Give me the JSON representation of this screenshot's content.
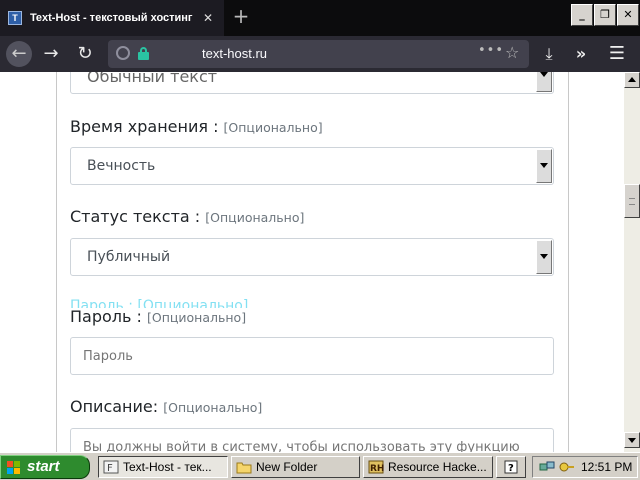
{
  "browser": {
    "tab_title": "Text-Host - текстовый хостинг",
    "tab_close": "✕",
    "tab_favicon_letter": "T",
    "new_tab": "+",
    "url": "text-host.ru",
    "page_actions": "•••",
    "accent_color": "#2ac3a2"
  },
  "window_controls": {
    "minimize": "_",
    "maximize": "❐",
    "close": "✕"
  },
  "form": {
    "top_select_value": "Обычный текст",
    "storage": {
      "label": "Время хранения :",
      "optional": "[Опционально]",
      "value": "Вечность"
    },
    "status": {
      "label": "Статус текста :",
      "optional": "[Опционально]",
      "value": "Публичный"
    },
    "password": {
      "label": "Пароль :",
      "optional": "[Опционально]",
      "placeholder": "Пароль"
    },
    "description": {
      "label": "Описание:",
      "optional": "[Опционально]",
      "placeholder": "Вы должны войти в систему, чтобы использовать эту функцию"
    }
  },
  "taskbar": {
    "start_label": "start",
    "tasks": [
      {
        "label": "Text-Host - тек...",
        "icon": "firefox-icon",
        "active": true
      },
      {
        "label": "New Folder",
        "icon": "folder-icon",
        "active": false
      },
      {
        "label": "Resource Hacke...",
        "icon": "resource-hacker-icon",
        "active": false
      },
      {
        "label": "",
        "icon": "help-icon",
        "active": false
      }
    ],
    "clock": "12:51 PM"
  }
}
